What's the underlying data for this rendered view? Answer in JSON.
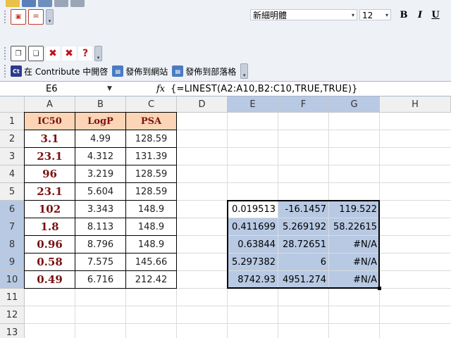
{
  "toolbar": {
    "font_name": "新細明體",
    "font_size": "12",
    "bold_label": "B",
    "italic_label": "I",
    "underline_label": "U",
    "contribute_open": "在 Contribute 中開啓",
    "publish_site": "發佈到網站",
    "publish_blog": "發佈到部落格",
    "contribute_badge": "Ct"
  },
  "formula_bar": {
    "name_box": "E6",
    "fx_label": "fx",
    "formula": "{=LINEST(A2:A10,B2:C10,TRUE,TRUE)}"
  },
  "columns": [
    "A",
    "B",
    "C",
    "D",
    "E",
    "F",
    "G",
    "H"
  ],
  "rows": [
    "1",
    "2",
    "3",
    "4",
    "5",
    "6",
    "7",
    "8",
    "9",
    "10",
    "11",
    "12",
    "13"
  ],
  "sheet": {
    "headers": [
      "IC50",
      "LogP",
      "PSA"
    ],
    "data": [
      [
        "3.1",
        "4.99",
        "128.59"
      ],
      [
        "23.1",
        "4.312",
        "131.39"
      ],
      [
        "96",
        "3.219",
        "128.59"
      ],
      [
        "23.1",
        "5.604",
        "128.59"
      ],
      [
        "102",
        "3.343",
        "148.9"
      ],
      [
        "1.8",
        "8.113",
        "148.9"
      ],
      [
        "0.96",
        "8.796",
        "148.9"
      ],
      [
        "0.58",
        "7.575",
        "145.66"
      ],
      [
        "0.49",
        "6.716",
        "212.42"
      ]
    ],
    "results": [
      [
        "0.019513",
        "-16.1457",
        "119.522"
      ],
      [
        "0.411699",
        "5.269192",
        "58.22615"
      ],
      [
        "0.63844",
        "28.72651",
        "#N/A"
      ],
      [
        "5.297382",
        "6",
        "#N/A"
      ],
      [
        "8742.93",
        "4951.274",
        "#N/A"
      ]
    ]
  },
  "colors": {
    "header_fill": "#fbd5b5",
    "ic50_text": "#7a1212",
    "selection_fill": "#b8c9e3",
    "toolbar_bg": "#eef1f6"
  }
}
